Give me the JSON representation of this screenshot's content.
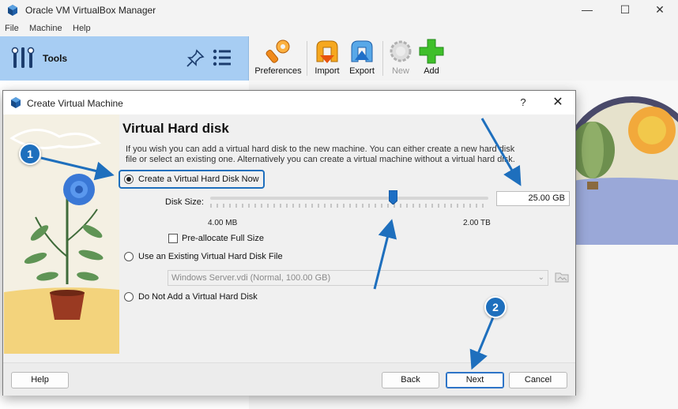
{
  "window": {
    "title": "Oracle VM VirtualBox Manager",
    "controls": {
      "minimize": "—",
      "maximize": "☐",
      "close": "✕"
    }
  },
  "menu": [
    "File",
    "Machine",
    "Help"
  ],
  "tools": {
    "label": "Tools"
  },
  "toolbar": {
    "preferences": "Preferences",
    "import": "Import",
    "export": "Export",
    "new": "New",
    "add": "Add"
  },
  "dialog": {
    "title": "Create Virtual Machine",
    "help_glyph": "?",
    "close_glyph": "✕",
    "page_title": "Virtual Hard disk",
    "description": "If you wish you can add a virtual hard disk to the new machine. You can either create a new hard disk file or select an existing one. Alternatively you can create a virtual machine without a virtual hard disk.",
    "options": {
      "create": "Create a Virtual Hard Disk Now",
      "existing": "Use an Existing Virtual Hard Disk File",
      "none": "Do Not Add a Virtual Hard Disk"
    },
    "selected_option": "create",
    "disk_size_label": "Disk Size:",
    "disk_size_value": "25.00 GB",
    "slider": {
      "min_label": "4.00 MB",
      "max_label": "2.00 TB"
    },
    "preallocate_label": "Pre-allocate Full Size",
    "preallocate_checked": false,
    "existing_file": "Windows Server.vdi (Normal, 100.00 GB)",
    "buttons": {
      "help": "Help",
      "back": "Back",
      "next": "Next",
      "cancel": "Cancel"
    }
  },
  "annotations": {
    "badge1": "1",
    "badge2": "2"
  },
  "colors": {
    "accent": "#1e6fbd",
    "tools_bg": "#a7cdf3"
  }
}
